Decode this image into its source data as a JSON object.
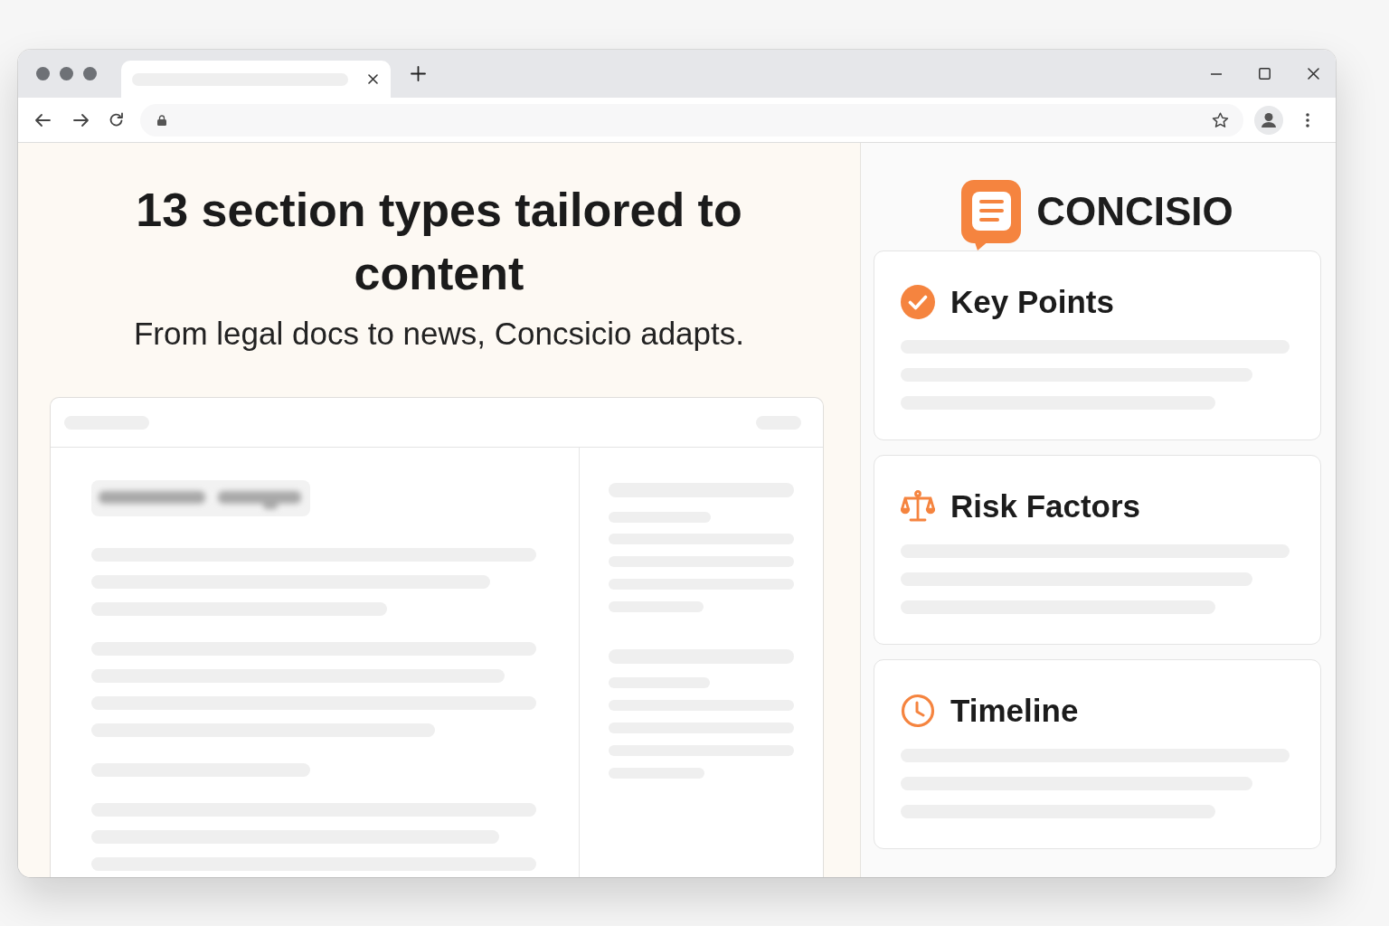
{
  "hero": {
    "title": "13 section types tailored to content",
    "subtitle": "From legal docs to news, Concsicio adapts."
  },
  "brand": {
    "name": "CONCISIO"
  },
  "sections": [
    {
      "kind": "check",
      "title": "Key Points"
    },
    {
      "kind": "scale",
      "title": "Risk Factors"
    },
    {
      "kind": "clock",
      "title": "Timeline"
    }
  ]
}
